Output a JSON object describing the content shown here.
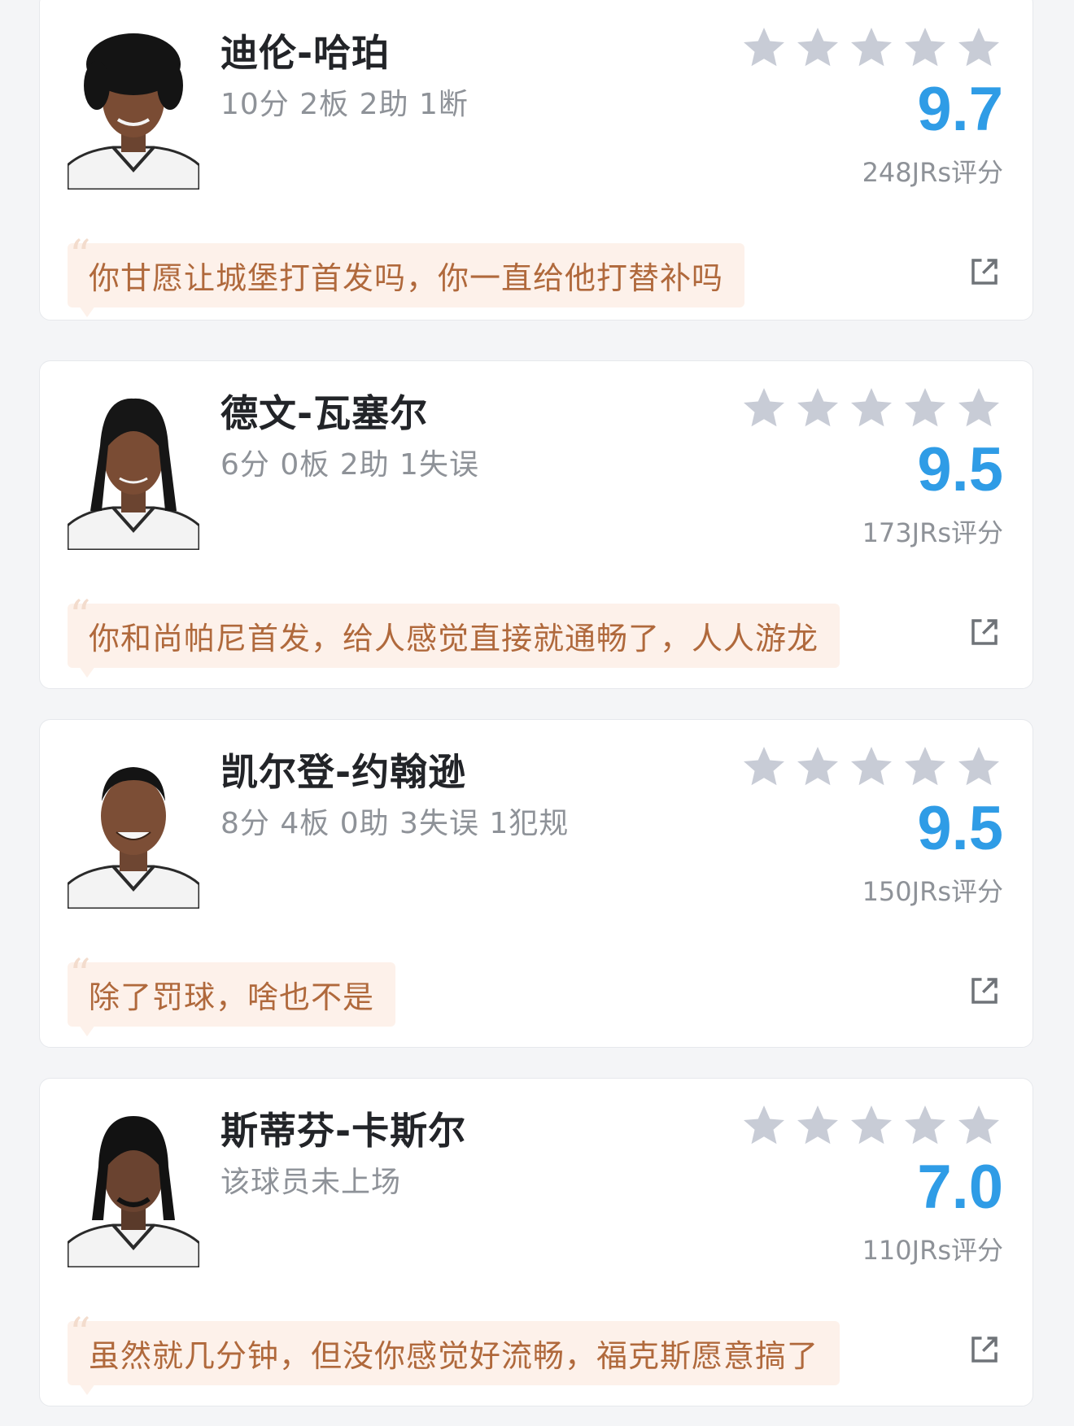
{
  "colors": {
    "accent": "#2f9ce6",
    "star": "#c8ccd6",
    "quote_bg": "#fdf1ea",
    "quote_text": "#b0693c",
    "muted": "#8e9298"
  },
  "icons": {
    "star": "star-icon",
    "share": "share-external-icon",
    "quote": "quote-mark-icon"
  },
  "players": [
    {
      "name": "迪伦-哈珀",
      "stats": "10分 2板 2助 1断",
      "score": "9.7",
      "raters": "248JRs评分",
      "stars_filled": 0,
      "comment": "你甘愿让城堡打首发吗，你一直给他打替补吗"
    },
    {
      "name": "德文-瓦塞尔",
      "stats": "6分 0板 2助 1失误",
      "score": "9.5",
      "raters": "173JRs评分",
      "stars_filled": 0,
      "comment": "你和尚帕尼首发，给人感觉直接就通畅了，人人游龙"
    },
    {
      "name": "凯尔登-约翰逊",
      "stats": "8分 4板 0助 3失误 1犯规",
      "score": "9.5",
      "raters": "150JRs评分",
      "stars_filled": 0,
      "comment": "除了罚球，啥也不是"
    },
    {
      "name": "斯蒂芬-卡斯尔",
      "stats": "该球员未上场",
      "score": "7.0",
      "raters": "110JRs评分",
      "stars_filled": 0,
      "comment": "虽然就几分钟，但没你感觉好流畅，福克斯愿意搞了"
    }
  ]
}
